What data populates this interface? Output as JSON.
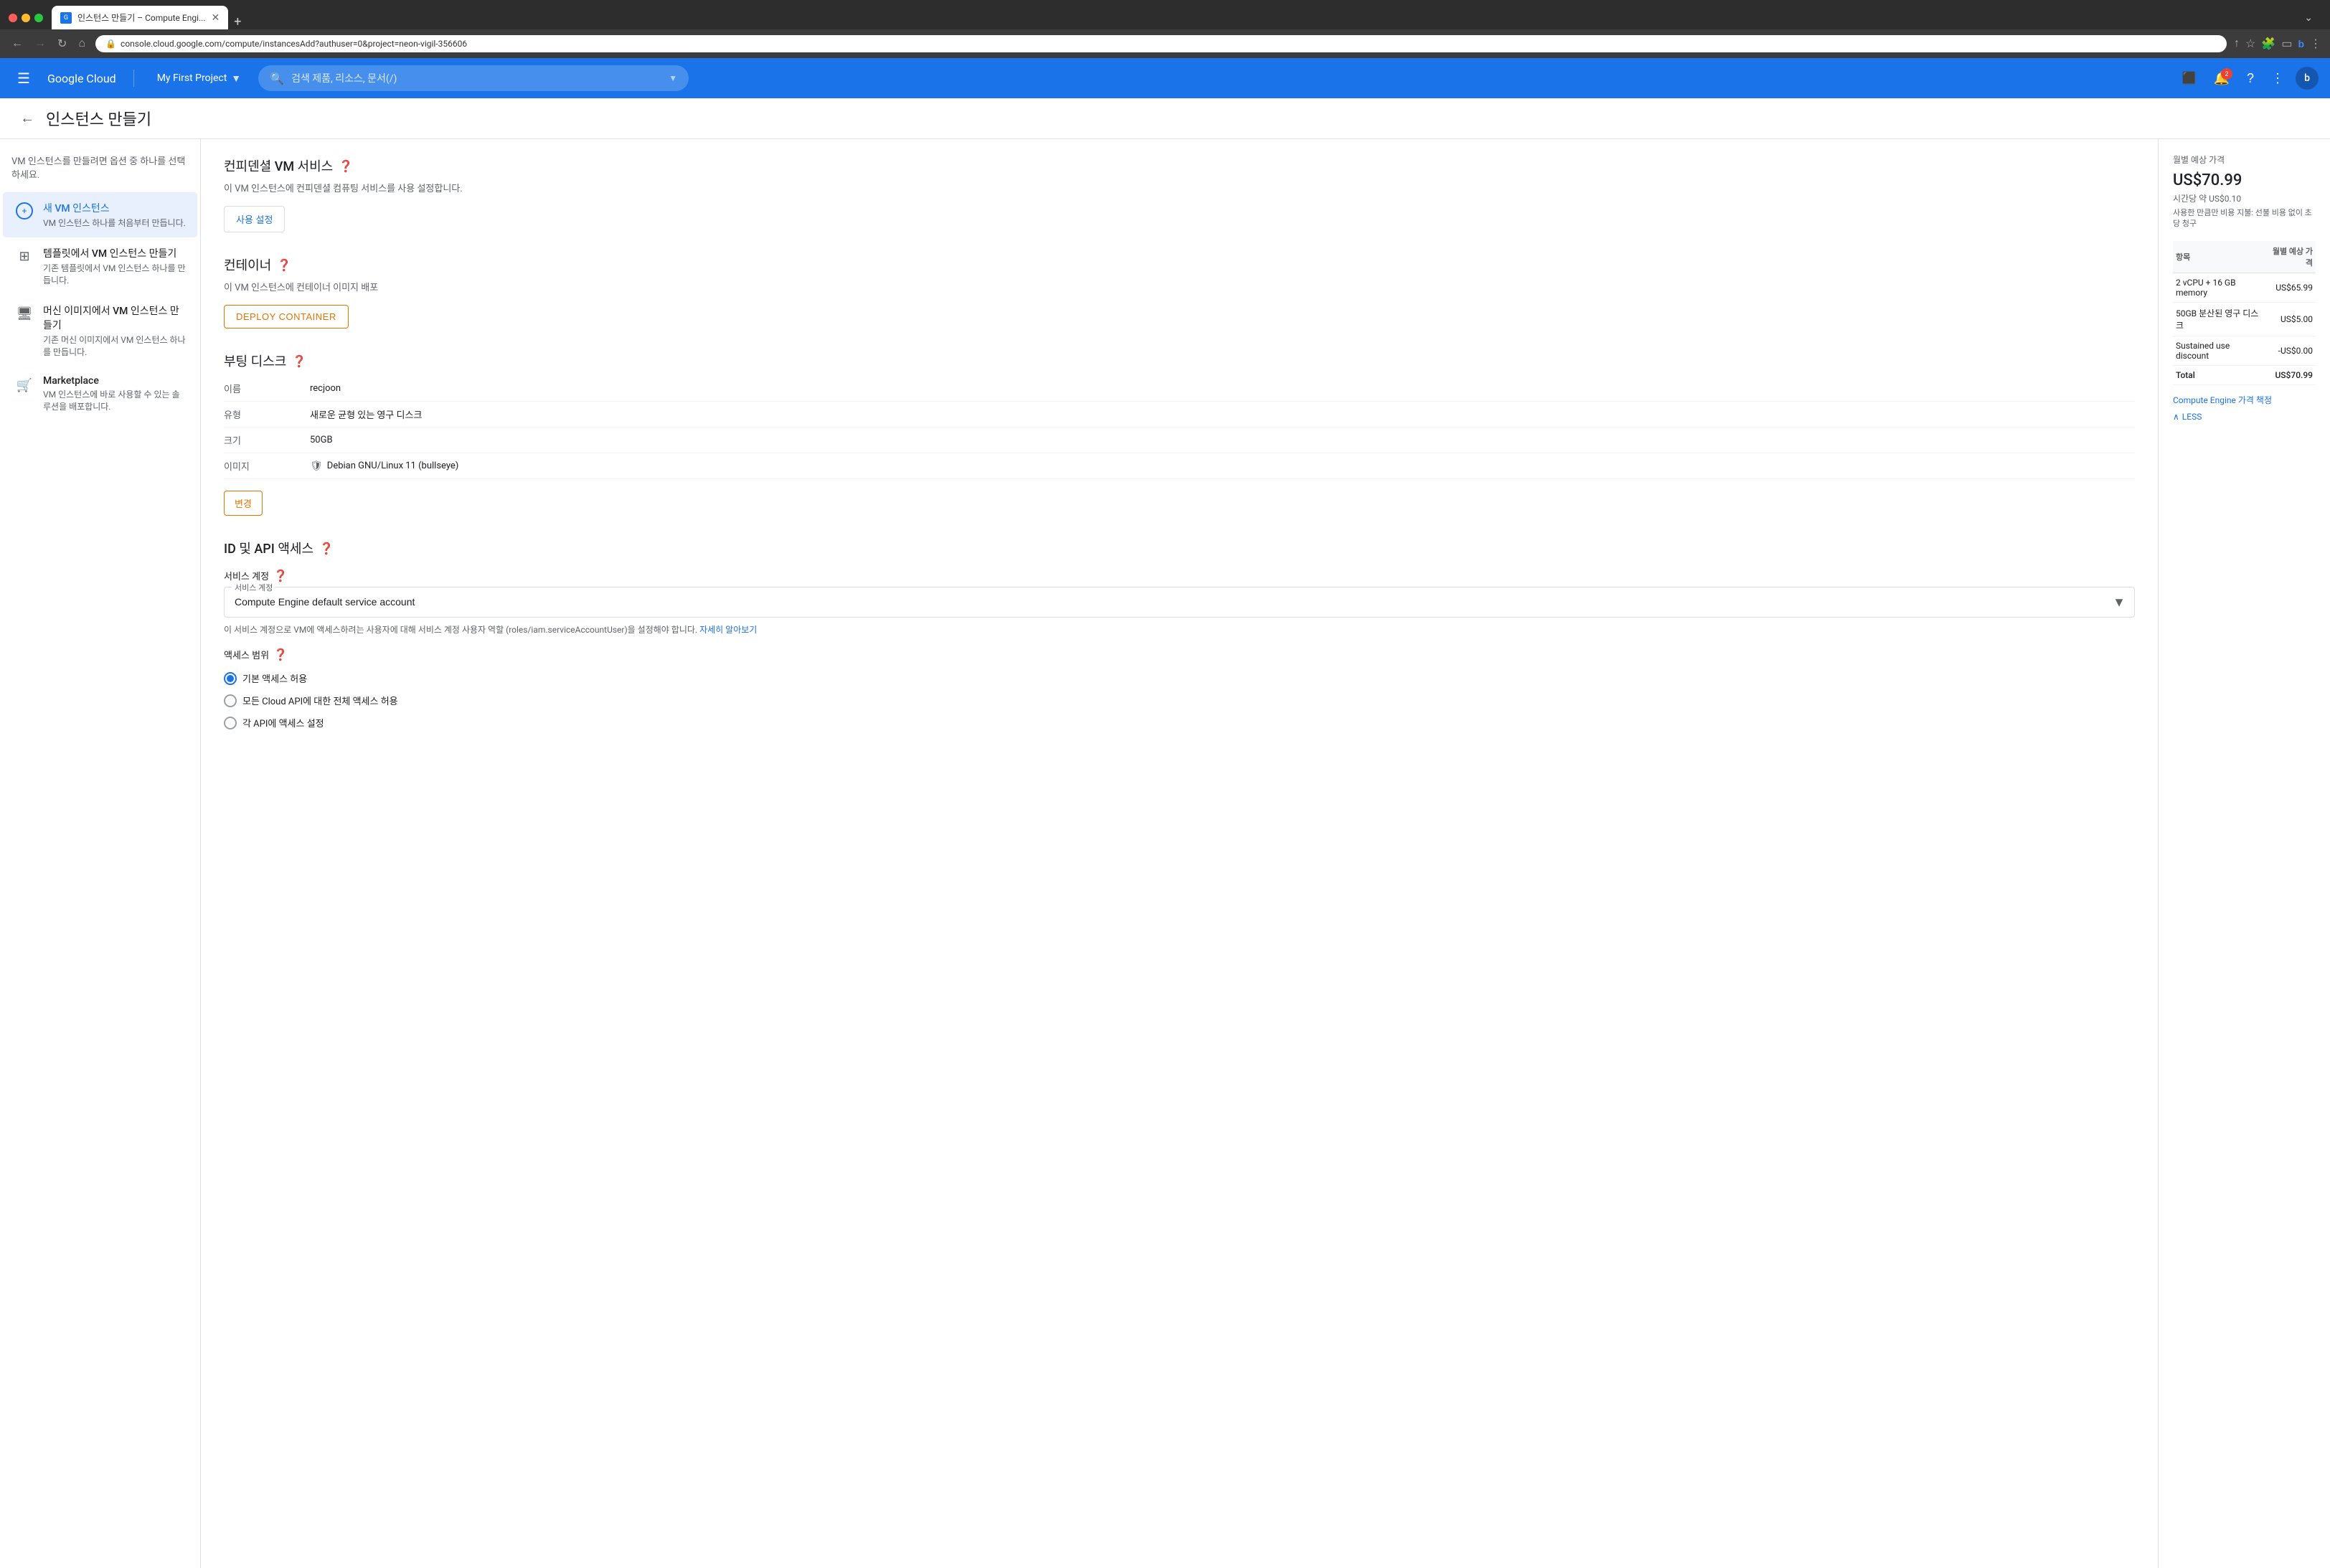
{
  "browser": {
    "tab_title": "인스턴스 만들기 – Compute Engi...",
    "address": "console.cloud.google.com/compute/instancesAdd?authuser=0&project=neon-vigil-356606",
    "new_tab_label": "+",
    "tab_menu_label": "⌄"
  },
  "header": {
    "logo": "Google Cloud",
    "logo_g": "G",
    "project_name": "My First Project",
    "search_placeholder": "검색  제품, 리소스, 문서(/)",
    "notification_count": "2",
    "avatar_letter": "b"
  },
  "page": {
    "back_label": "←",
    "title": "인스턴스 만들기"
  },
  "sidebar": {
    "hint": "VM 인스턴스를 만들려면 옵션 중 하나를 선택하세요.",
    "items": [
      {
        "id": "new-vm",
        "title": "새 VM 인스턴스",
        "subtitle": "VM 인스턴스 하나를 처음부터 만듭니다.",
        "active": true
      },
      {
        "id": "template-vm",
        "title": "템플릿에서 VM 인스턴스 만들기",
        "subtitle": "기존 템플릿에서 VM 인스턴스 하나를 만듭니다.",
        "active": false
      },
      {
        "id": "machine-image-vm",
        "title": "머신 이미지에서 VM 인스턴스 만들기",
        "subtitle": "기존 머신 이미지에서 VM 인스턴스 하나를 만듭니다.",
        "active": false
      },
      {
        "id": "marketplace",
        "title": "Marketplace",
        "subtitle": "VM 인스턴스에 바로 사용할 수 있는 솔루션을 배포합니다.",
        "active": false
      }
    ]
  },
  "main": {
    "confidential_vm": {
      "title": "컨피덴셜 VM 서비스",
      "description": "이 VM 인스턴스에 컨피덴셜 컴퓨팅 서비스를 사용 설정합니다.",
      "button_label": "사용 설정"
    },
    "container": {
      "title": "컨테이너",
      "description": "이 VM 인스턴스에 컨테이너 이미지 배포",
      "button_label": "DEPLOY CONTAINER"
    },
    "boot_disk": {
      "title": "부팅 디스크",
      "fields": [
        {
          "label": "이름",
          "value": "recjoon"
        },
        {
          "label": "유형",
          "value": "새로운 균형 있는 영구 디스크"
        },
        {
          "label": "크기",
          "value": "50GB"
        },
        {
          "label": "이미지",
          "value": "Debian GNU/Linux 11 (bullseye)"
        }
      ],
      "change_button": "변경"
    },
    "id_api": {
      "title": "ID 및 API 액세스",
      "service_account": {
        "label": "서비스 계정",
        "floating_label": "서비스 계정",
        "value": "Compute Engine default service account",
        "note": "이 서비스 계정으로 VM에 액세스하려는 사용자에 대해 서비스 계정 사용자 역할 (roles/iam.serviceAccountUser)을 설정해야 합니다.",
        "link_text": "자세히 알아보기"
      },
      "access_scope": {
        "label": "액세스 범위",
        "options": [
          {
            "label": "기본 액세스 허용",
            "checked": true
          },
          {
            "label": "모든 Cloud API에 대한 전체 액세스 허용",
            "checked": false
          },
          {
            "label": "각 API에 액세스 설정",
            "checked": false
          }
        ]
      }
    }
  },
  "price_panel": {
    "title": "월별 예상 가격",
    "main_price": "US$70.99",
    "hourly": "시간당 약 US$0.10",
    "note": "사용한 만큼만 비용 지불: 선불 비용 없이 초당 청구",
    "table_headers": [
      "항목",
      "월별 예상 가격"
    ],
    "rows": [
      {
        "item": "2 vCPU + 16 GB memory",
        "price": "US$65.99"
      },
      {
        "item": "50GB 분산된 영구 디스크",
        "price": "US$5.00"
      },
      {
        "item": "Sustained use discount",
        "price": "-US$0.00",
        "discount": true
      },
      {
        "item": "Total",
        "price": "US$70.99",
        "total": true
      }
    ],
    "link_text": "Compute Engine 가격 책정",
    "less_label": "LESS"
  }
}
